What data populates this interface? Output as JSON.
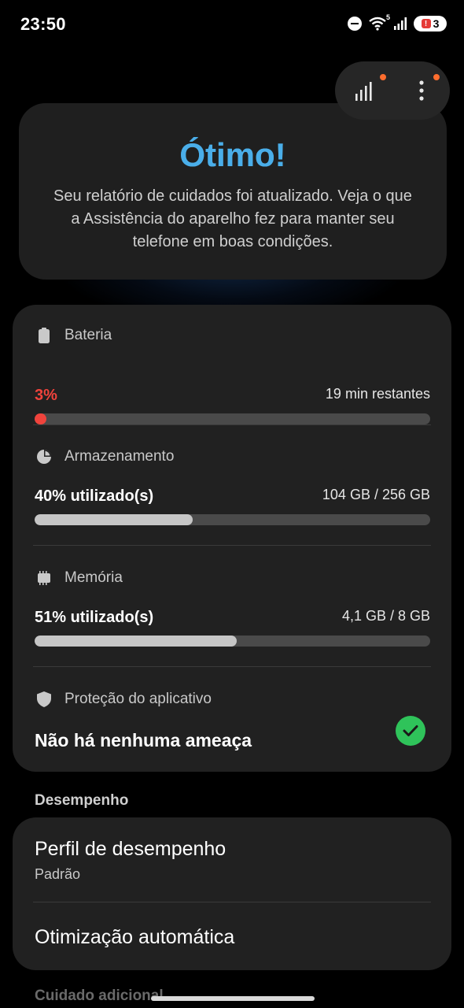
{
  "status_bar": {
    "time": "23:50",
    "notification_count": "3",
    "wifi_label": "5"
  },
  "hero": {
    "title": "Ótimo!",
    "description": "Seu relatório de cuidados foi atualizado. Veja o que a Assistência do aparelho fez para manter seu telefone em boas condições."
  },
  "battery": {
    "title": "Bateria",
    "percent": "3%",
    "remaining": "19 min restantes",
    "level": 0.03
  },
  "storage": {
    "title": "Armazenamento",
    "used": "40% utilizado(s)",
    "amount": "104 GB / 256 GB",
    "level": 0.4
  },
  "memory": {
    "title": "Memória",
    "used": "51% utilizado(s)",
    "amount": "4,1 GB / 8 GB",
    "level": 0.51
  },
  "protection": {
    "title": "Proteção do aplicativo",
    "status": "Não há nenhuma ameaça"
  },
  "performance": {
    "section_label": "Desempenho",
    "profile_title": "Perfil de desempenho",
    "profile_value": "Padrão",
    "auto_optimization": "Otimização automática"
  },
  "extra_section_label": "Cuidado adicional",
  "colors": {
    "accent": "#4aaee9",
    "battery_low": "#f0433c",
    "bar_fill": "#c6c6c6",
    "check": "#2fc35a",
    "notification_dot": "#ff6d2e"
  }
}
